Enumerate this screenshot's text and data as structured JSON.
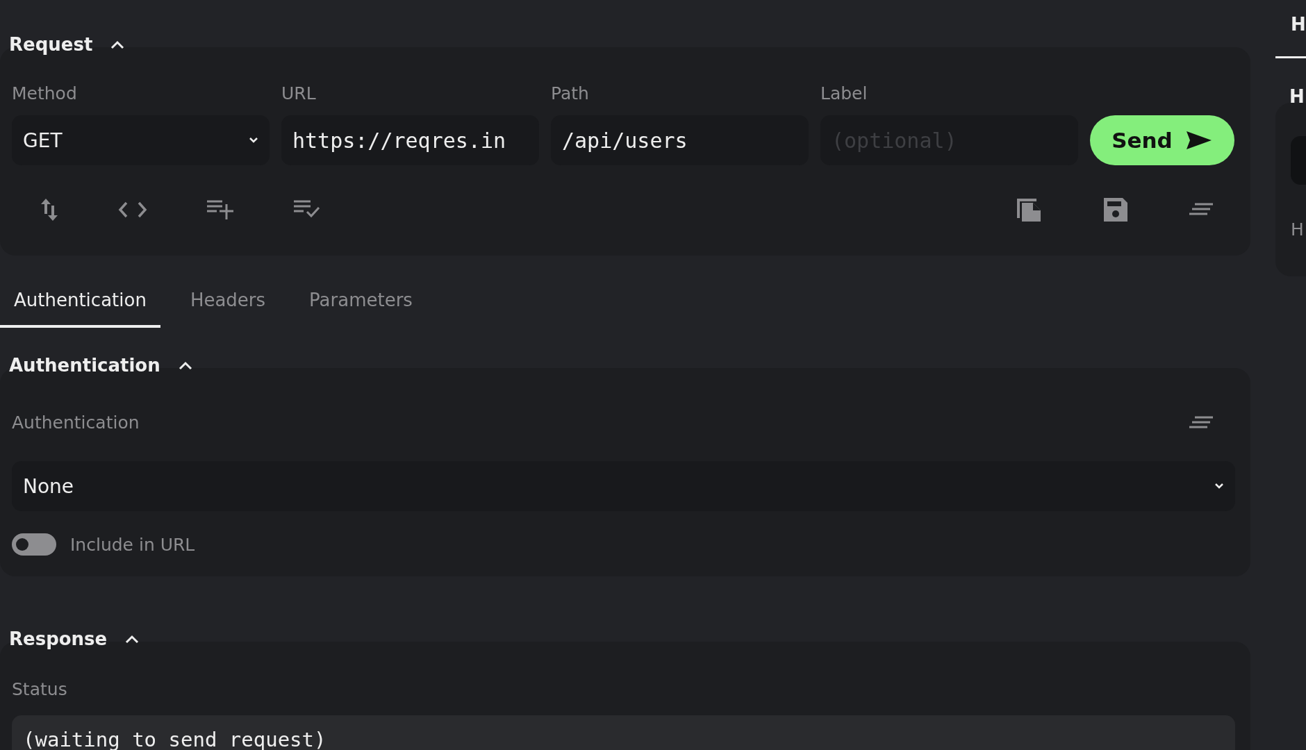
{
  "request": {
    "title": "Request",
    "expanded": true,
    "fields": [
      {
        "kind": "select",
        "label": "Method",
        "value": "GET"
      },
      {
        "kind": "text",
        "label": "URL",
        "value": "https://reqres.in"
      },
      {
        "kind": "text",
        "label": "Path",
        "value": "/api/users"
      },
      {
        "kind": "text",
        "label": "Label",
        "placeholder": "(optional)"
      }
    ],
    "send_button": "Send"
  },
  "tabs": [
    {
      "label": "Authentication",
      "selected": true
    },
    {
      "label": "Headers",
      "selected": false
    },
    {
      "label": "Parameters",
      "selected": false
    }
  ],
  "authentication": {
    "title": "Authentication",
    "expanded": true,
    "label": "Authentication",
    "value": "None",
    "include_in_url": {
      "label": "Include in URL",
      "on": false
    }
  },
  "response": {
    "title": "Response",
    "expanded": true,
    "status_label": "Status",
    "status": "(waiting to send request)"
  },
  "side_panel": {
    "tabs": [
      {
        "label": "H",
        "selected": true
      }
    ],
    "title": "H",
    "field_label": "H"
  }
}
